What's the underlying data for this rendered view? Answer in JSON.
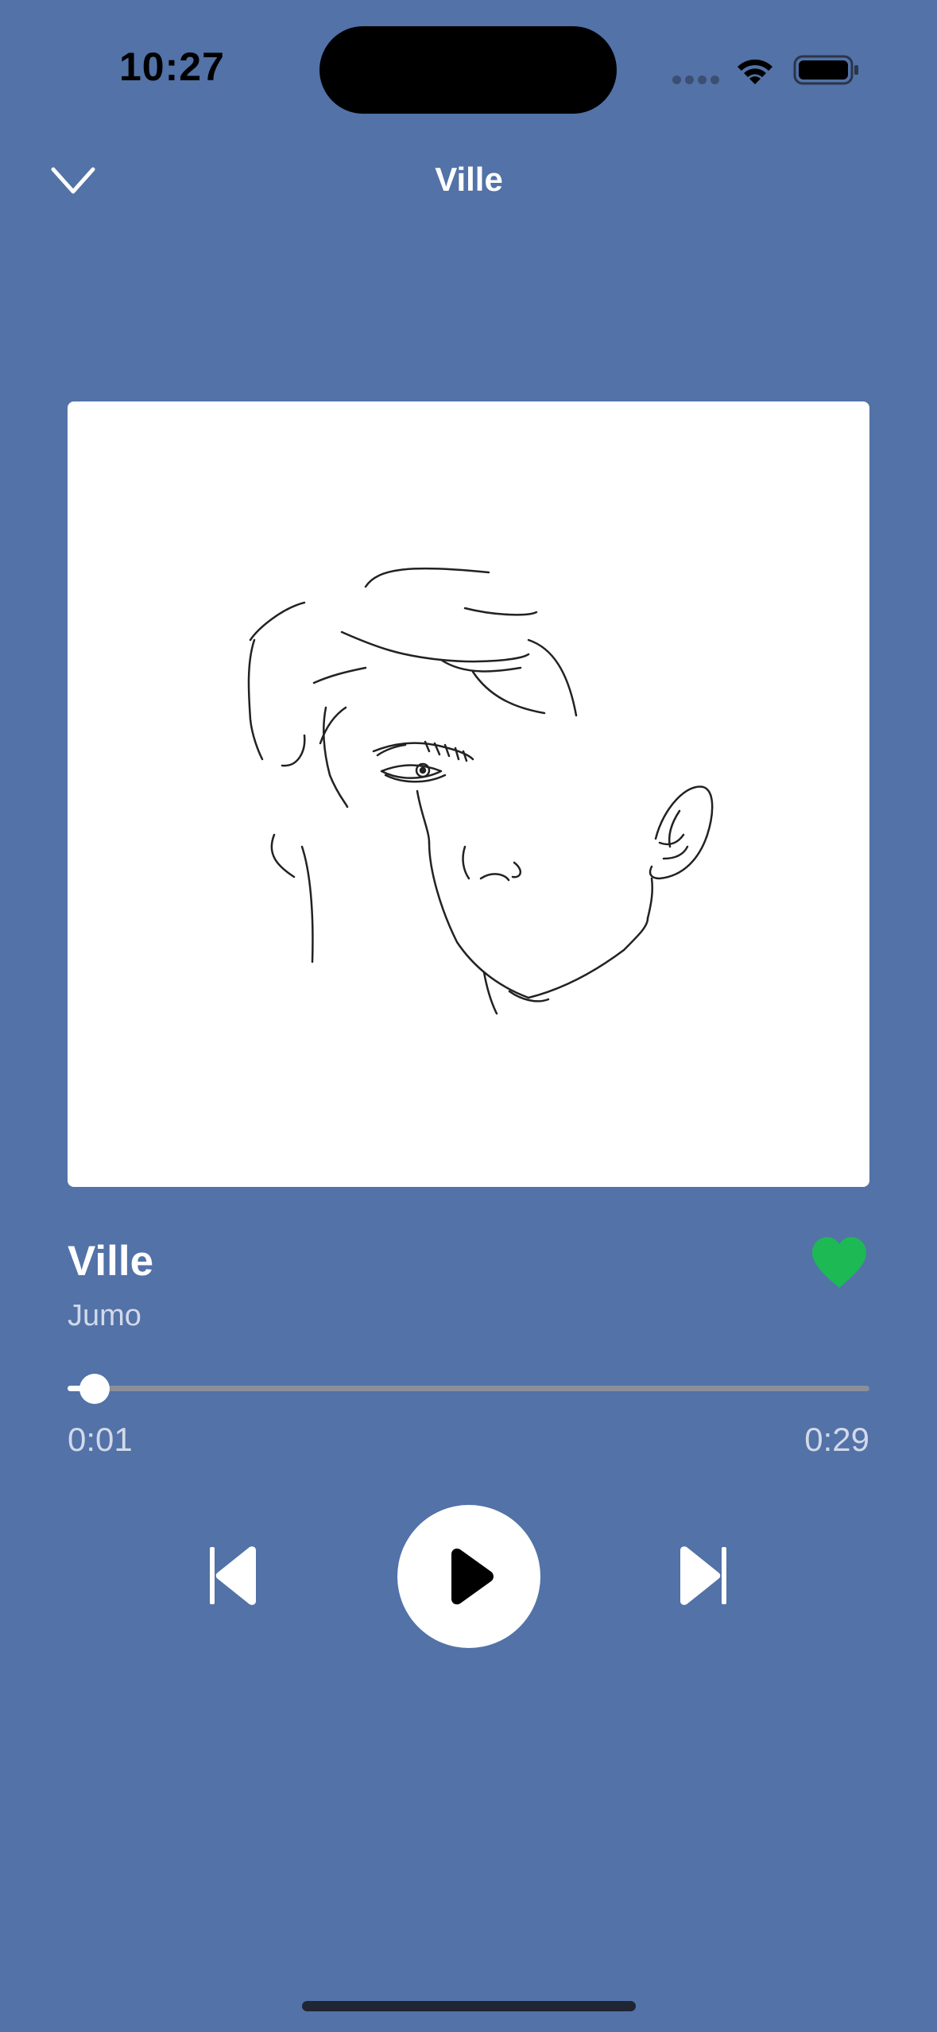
{
  "status_bar": {
    "time": "10:27"
  },
  "header": {
    "collapse_icon": "chevron-down-icon",
    "title": "Ville"
  },
  "artwork": {
    "description_icon": "line-drawing-face"
  },
  "track": {
    "title": "Ville",
    "artist": "Jumo",
    "liked": true
  },
  "progress": {
    "elapsed": "0:01",
    "total": "0:29",
    "fraction": 0.034
  },
  "controls": {
    "previous_icon": "skip-previous-icon",
    "play_icon": "play-icon",
    "next_icon": "skip-next-icon"
  },
  "colors": {
    "background": "#5272a8",
    "accent_like": "#1db954",
    "progress_track": "#8b8f98",
    "progress_fill": "#ffffff"
  }
}
